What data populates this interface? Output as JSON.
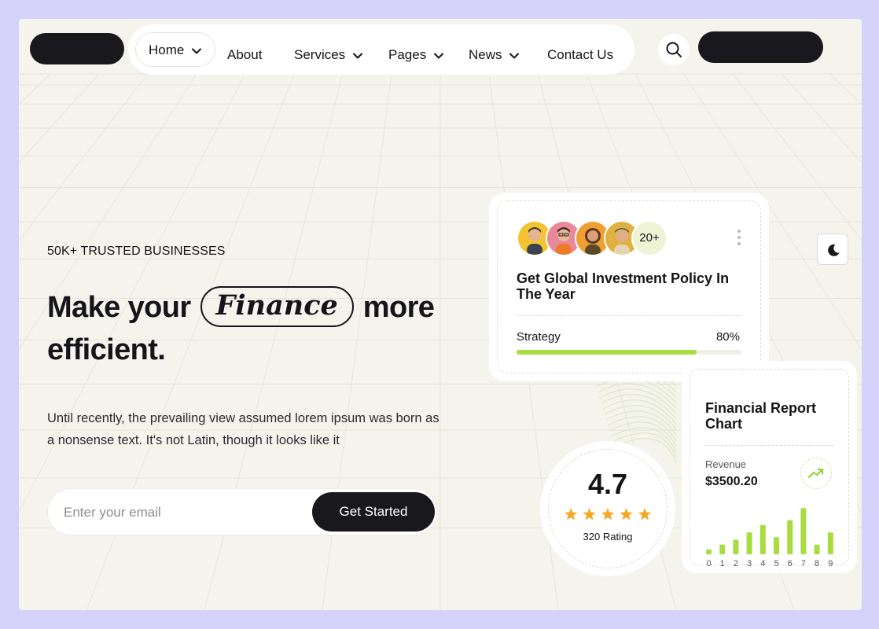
{
  "nav": {
    "items": [
      {
        "label": "Home",
        "dropdown": true,
        "active": true
      },
      {
        "label": "About",
        "dropdown": false
      },
      {
        "label": "Services",
        "dropdown": true
      },
      {
        "label": "Pages",
        "dropdown": true
      },
      {
        "label": "News",
        "dropdown": true
      },
      {
        "label": "Contact Us",
        "dropdown": false
      }
    ],
    "search_icon": "search-icon"
  },
  "hero": {
    "eyebrow": "50K+ TRUSTED BUSINESSES",
    "headline_before": "Make your",
    "headline_highlight": "Finance",
    "headline_after": "more efficient.",
    "description": "Until recently, the prevailing view assumed lorem ipsum was born as a nonsense text. It's not Latin, though it looks like it",
    "email_placeholder": "Enter your email",
    "email_value": "",
    "cta_label": "Get Started"
  },
  "investment_card": {
    "avatar_extra": "20+",
    "title": "Get Global Investment Policy In The Year",
    "progress_label": "Strategy",
    "progress_value_text": "80%",
    "progress_fraction": 0.8
  },
  "rating_card": {
    "value": "4.7",
    "stars": 5,
    "count_label": "320 Rating"
  },
  "report_card": {
    "title": "Financial Report Chart",
    "revenue_label": "Revenue",
    "revenue_value": "$3500.20",
    "trend_icon": "trend-up-icon"
  },
  "chart_data": {
    "type": "bar",
    "categories": [
      "0",
      "1",
      "2",
      "3",
      "4",
      "5",
      "6",
      "7",
      "8",
      "9"
    ],
    "values": [
      1,
      2,
      3,
      4.5,
      6,
      3.5,
      7,
      9.5,
      2,
      4.5
    ],
    "title": "",
    "xlabel": "",
    "ylabel": "",
    "ylim": [
      0,
      10
    ],
    "grid": false,
    "bar_color": "#a8dc3f"
  },
  "colors": {
    "page_bg": "#d4d2fa",
    "canvas_bg": "#f4f4ec",
    "dark": "#18181d",
    "accent_green": "#a8dc3f",
    "star": "#f5a623"
  },
  "theme_toggle_icon": "moon-icon"
}
